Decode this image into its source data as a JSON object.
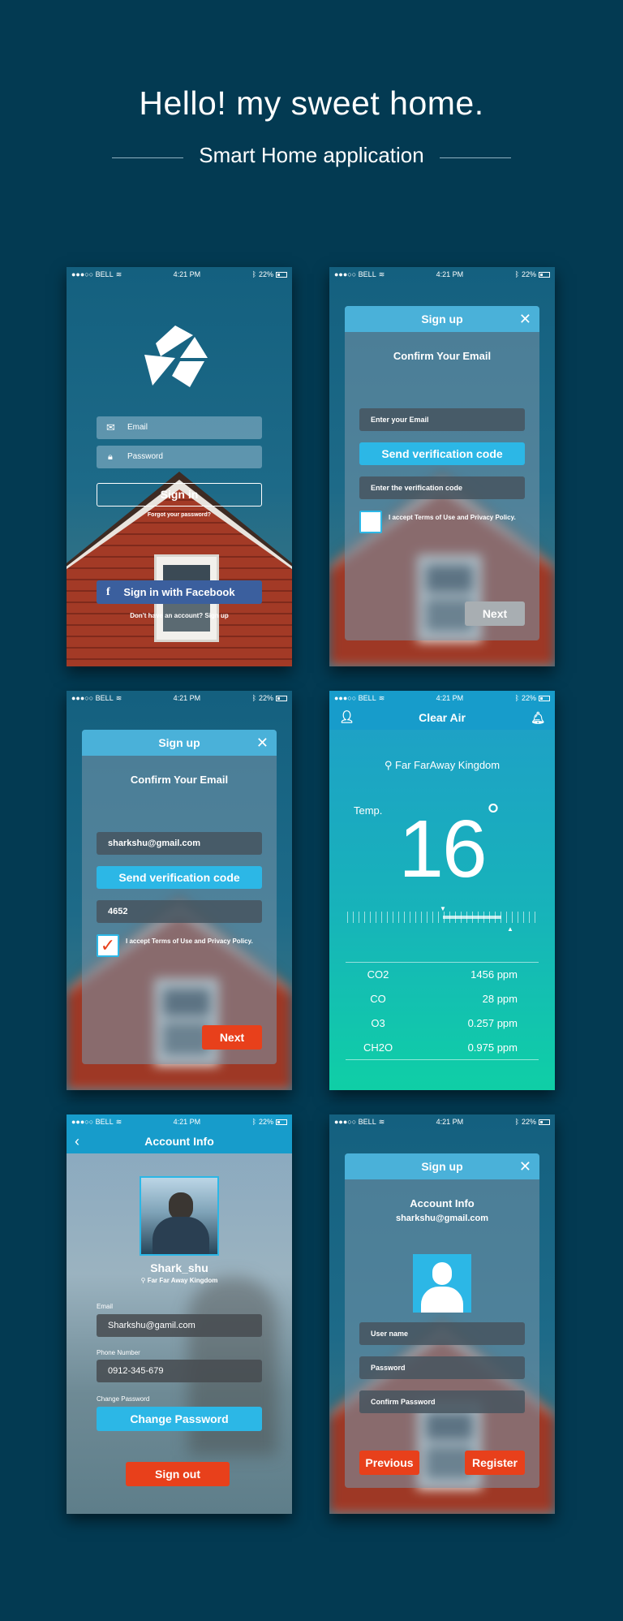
{
  "hero": {
    "title": "Hello! my sweet home.",
    "subtitle": "Smart Home application"
  },
  "status": {
    "carrier": "●●●○○ BELL",
    "wifi": "✈︎",
    "time": "4:21 PM",
    "battery": "22%"
  },
  "login": {
    "email_label": "Email",
    "password_label": "Password",
    "signin": "Sign in",
    "forgot": "Forgot your password?",
    "facebook": "Sign in with Facebook",
    "signup_prompt": "Don't have an account? Sign up"
  },
  "signup_email_empty": {
    "header": "Sign up",
    "title": "Confirm Your Email",
    "email_placeholder": "Enter your Email",
    "send_code": "Send verification code",
    "code_placeholder": "Enter the verification code",
    "terms": "I accept Terms of Use and Privacy Policy.",
    "next": "Next"
  },
  "signup_email_filled": {
    "header": "Sign up",
    "title": "Confirm Your Email",
    "email_value": "sharkshu@gmail.com",
    "send_code": "Send verification code",
    "code_value": "4652",
    "terms": "I accept Terms of Use and Privacy Policy.",
    "next": "Next"
  },
  "clear_air": {
    "header": "Clear Air",
    "location": "Far FarAway Kingdom",
    "temp_label": "Temp.",
    "temp_value": "16",
    "degree": "°",
    "rows": [
      {
        "name": "CO2",
        "value": "1456 ppm"
      },
      {
        "name": "CO",
        "value": "28 ppm"
      },
      {
        "name": "O3",
        "value": "0.257 ppm"
      },
      {
        "name": "CH2O",
        "value": "0.975 ppm"
      }
    ]
  },
  "account_info": {
    "header": "Account Info",
    "username": "Shark_shu",
    "location": "Far Far Away Kingdom",
    "email_label": "Email",
    "email_value": "Sharkshu@gamil.com",
    "phone_label": "Phone Number",
    "phone_value": "0912-345-679",
    "change_label": "Change Password",
    "change_btn": "Change Password",
    "signout": "Sign out"
  },
  "signup_account": {
    "header": "Sign up",
    "title": "Account Info",
    "email": "sharkshu@gmail.com",
    "username_placeholder": "User name",
    "password_placeholder": "Password",
    "confirm_placeholder": "Confirm Password",
    "previous": "Previous",
    "register": "Register"
  },
  "colors": {
    "background": "#033a52",
    "accent_blue": "#2cb7e6",
    "accent_orange": "#e8401b",
    "facebook": "#3b5f9e"
  }
}
